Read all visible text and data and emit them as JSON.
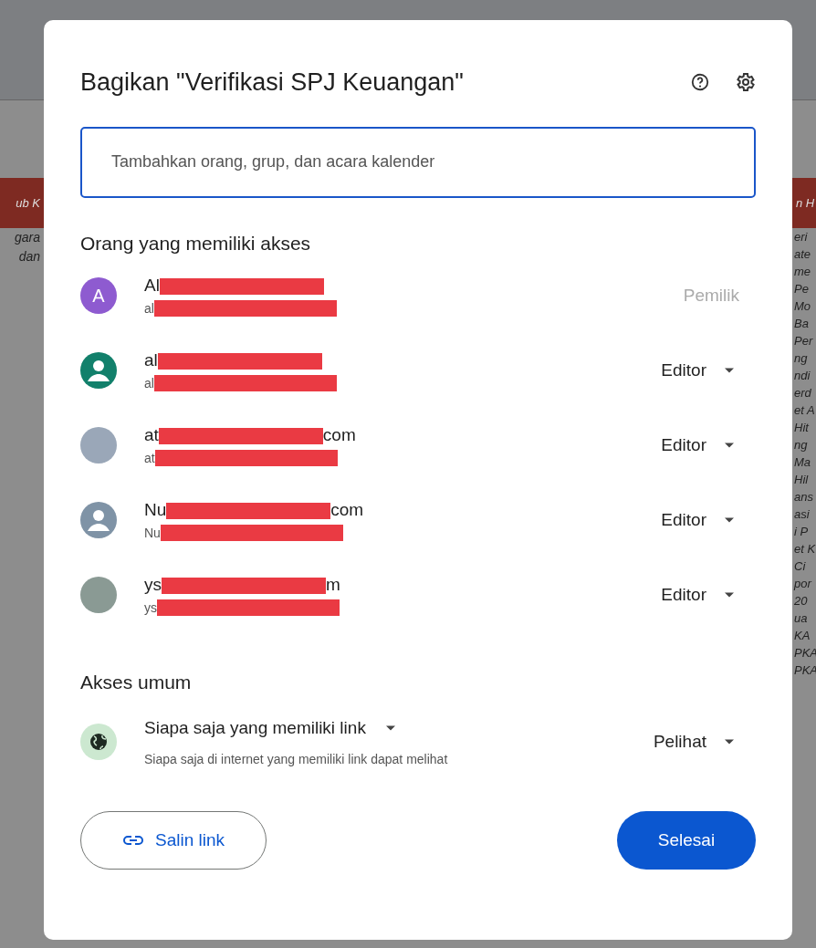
{
  "background": {
    "left_fragments": [
      "gara",
      "dan"
    ],
    "left_header": "ub K",
    "right_header": "n H",
    "right_fragments": [
      "eri",
      "ate",
      "me",
      "Pe",
      "Mo",
      "Ba",
      "Per",
      "ng",
      "ndi",
      "erd",
      "et A",
      "Hit",
      "ng",
      "Ma",
      "Hil",
      "ans",
      "asi",
      "i P",
      "et K",
      "Ci",
      "por",
      "20",
      "ua",
      "KA",
      "PKA",
      "PKA"
    ]
  },
  "dialog": {
    "title": "Bagikan \"Verifikasi SPJ Keuangan\"",
    "search": {
      "placeholder": "Tambahkan orang, grup, dan acara kalender"
    },
    "people_heading": "Orang yang memiliki akses",
    "people": [
      {
        "kind": "initial",
        "avatar_text": "A",
        "color": "#8e5bd0",
        "name_start": "Al",
        "email_start": "al",
        "role": "Pemilik",
        "role_disabled": true
      },
      {
        "kind": "silhouette",
        "color": "#12806b",
        "name_start": "al",
        "email_start": "al",
        "role": "Editor",
        "role_disabled": false
      },
      {
        "kind": "photo",
        "color": "#9aa7b8",
        "name_start": "at",
        "name_end": "com",
        "email_start": "at",
        "role": "Editor",
        "role_disabled": false
      },
      {
        "kind": "silhouette",
        "color": "#7f93a6",
        "name_start": "Nu",
        "name_end": "com",
        "email_start": "Nu",
        "role": "Editor",
        "role_disabled": false
      },
      {
        "kind": "photo",
        "color": "#8a9a94",
        "name_start": "ys",
        "name_end": "m",
        "email_start": "ys",
        "role": "Editor",
        "role_disabled": false
      }
    ],
    "general_heading": "Akses umum",
    "general": {
      "access": "Siapa saja yang memiliki link",
      "description": "Siapa saja di internet yang memiliki link dapat melihat",
      "role": "Pelihat"
    },
    "copy_link": "Salin link",
    "done": "Selesai"
  }
}
